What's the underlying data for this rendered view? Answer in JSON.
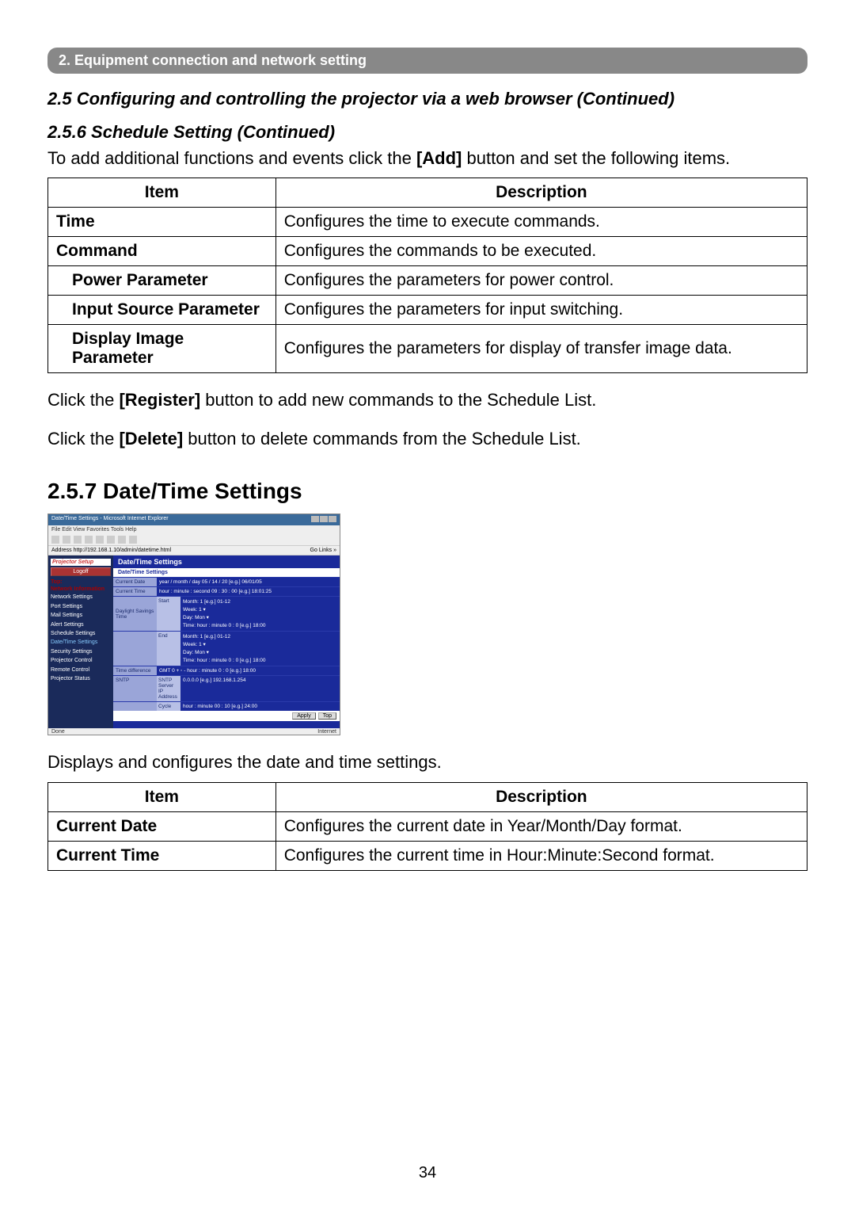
{
  "header_bar": "2. Equipment connection and network setting",
  "section_title": "2.5 Configuring and controlling the projector via a web browser (Continued)",
  "subsection_title": "2.5.6 Schedule Setting (Continued)",
  "intro_line1": "To add additional functions and events click the ",
  "intro_add": "[Add]",
  "intro_line2": " button and set the following items.",
  "table1": {
    "header_item": "Item",
    "header_desc": "Description",
    "rows": [
      {
        "item": "Time",
        "desc": "Configures the time to execute commands.",
        "indent": false
      },
      {
        "item": "Command",
        "desc": "Configures the commands to be executed.",
        "indent": false
      },
      {
        "item": "Power Parameter",
        "desc": "Configures the parameters for power control.",
        "indent": true
      },
      {
        "item": "Input Source Parameter",
        "desc": "Configures the parameters for input switching.",
        "indent": true
      },
      {
        "item": "Display Image Parameter",
        "desc": "Configures the parameters for display of transfer image data.",
        "indent": true
      }
    ]
  },
  "para_register_pre": "Click the ",
  "para_register_btn": "[Register]",
  "para_register_post": " button to add new commands to the Schedule List.",
  "para_delete_pre": "Click the ",
  "para_delete_btn": "[Delete]",
  "para_delete_post": " button to delete commands from the Schedule List.",
  "subheading_257": "2.5.7 Date/Time Settings",
  "screenshot": {
    "window_title": "Date/Time Settings - Microsoft Internet Explorer",
    "menubar": "File  Edit  View  Favorites  Tools  Help",
    "toolbar": "Back  ▾  ▸  ✕  ⟳  🏠  Search  Favorites  Media",
    "address_label": "Address",
    "address_value": "http://192.168.1.10/admin/datetime.html",
    "address_right": "Go  Links »",
    "sidebar": {
      "brand": "Projector Setup",
      "logoff": "Logoff",
      "top": "Top:",
      "netinfo": "Network Information",
      "items": [
        "Network Settings",
        "Port Settings",
        "Mail Settings",
        "Alert Settings",
        "Schedule Settings",
        "Date/Time Settings",
        "Security Settings",
        "Projector Control",
        "Remote Control",
        "Projector Status"
      ],
      "active_index": 5
    },
    "main": {
      "tab_header": "Date/Time Settings",
      "panel_title": "Date/Time Settings",
      "current_date_label": "Current Date",
      "current_date_value": "year / month / day  05 / 14 / 20   [e.g.] 06/01/05",
      "current_time_label": "Current Time",
      "current_time_value": "hour : minute : second  09 : 30 : 00   [e.g.] 18:01:25",
      "daylight_label": "Daylight Savings Time",
      "start_label": "Start",
      "start_lines": "Month: 1  [e.g.] 01-12\nWeek: 1 ▾\nDay: Mon ▾\nTime: hour : minute 0 : 0  [e.g.] 18:00",
      "end_label": "End",
      "end_lines": "Month: 1  [e.g.] 01-12\nWeek: 1 ▾\nDay: Mon ▾\nTime: hour : minute 0 : 0  [e.g.] 18:00",
      "timediff_label": "Time difference",
      "timediff_value": "GMT  0 +  ◦ -   hour : minute 0 : 0  [e.g.] 18:00",
      "sntp_label": "SNTP",
      "sntp_server_label": "SNTP Server IP Address",
      "sntp_server_value": "0.0.0.0        [e.g.] 192.168.1.254",
      "cycle_label": "Cycle",
      "cycle_value": "hour : minute  00 : 10  [e.g.] 24:00",
      "apply_btn": "Apply",
      "top_btn": "Top"
    },
    "statusbar_left": "Done",
    "statusbar_right": "Internet"
  },
  "para_257": "Displays and configures the date and time settings.",
  "table2": {
    "header_item": "Item",
    "header_desc": "Description",
    "rows": [
      {
        "item": "Current Date",
        "desc": "Configures the current date in Year/Month/Day format."
      },
      {
        "item": "Current Time",
        "desc": "Configures the current time in Hour:Minute:Second format."
      }
    ]
  },
  "page_number": "34"
}
